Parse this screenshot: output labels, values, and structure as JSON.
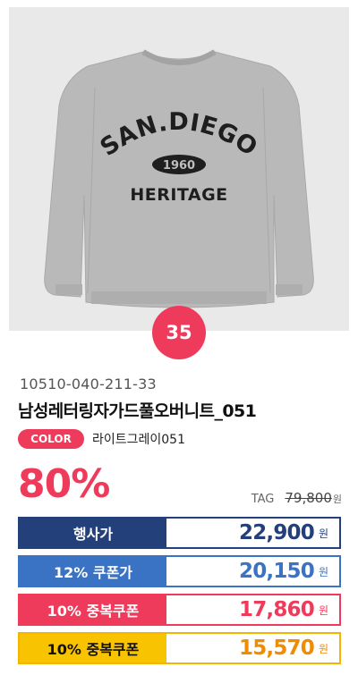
{
  "product": {
    "image_alt": "sweater-image",
    "print_lines": [
      "SAN.DIEGO",
      "1960",
      "HERITAGE"
    ],
    "rank_badge": "35",
    "code": "10510-040-211-33",
    "name": "남성레터링자가드풀오버니트_051",
    "color_label": "COLOR",
    "color_value": "라이트그레이051"
  },
  "pricing": {
    "discount": "80%",
    "tag_label": "TAG",
    "tag_price": "79,800",
    "tag_unit": "원",
    "rows": [
      {
        "label": "행사가",
        "value": "22,900",
        "unit": "원",
        "color": "#23407a"
      },
      {
        "label": "12% 쿠폰가",
        "value": "20,150",
        "unit": "원",
        "color": "#3a72c4"
      },
      {
        "label": "10% 중복쿠폰",
        "value": "17,860",
        "unit": "원",
        "color": "#ef3b5b"
      },
      {
        "label": "10% 중복쿠폰",
        "value": "15,570",
        "unit": "원",
        "color": "#f8c300"
      }
    ]
  },
  "colors": {
    "accent_pink": "#ef3b5b",
    "navy": "#23407a",
    "blue": "#3a72c4",
    "yellow": "#f8c300"
  }
}
